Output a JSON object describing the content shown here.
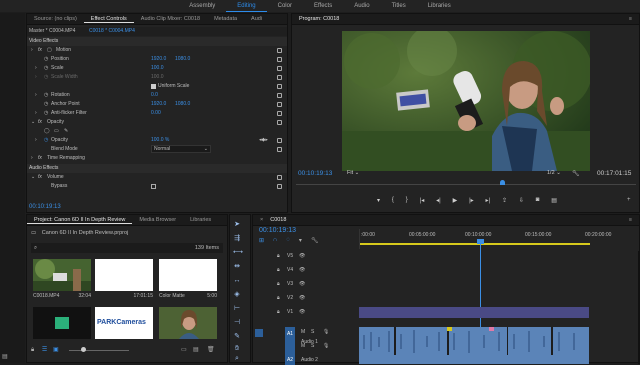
{
  "workspaces": [
    {
      "label": "Assembly"
    },
    {
      "label": "Editing",
      "active": true
    },
    {
      "label": "Color"
    },
    {
      "label": "Effects"
    },
    {
      "label": "Audio"
    },
    {
      "label": "Titles"
    },
    {
      "label": "Libraries"
    }
  ],
  "source_tabs": [
    "Source: (no clips)",
    "Effect Controls",
    "Audio Clip Mixer: C0018",
    "Metadata",
    "Audi"
  ],
  "effect_controls": {
    "master": "Master * C0004.MP4",
    "clip": "C0018 * C0004.MP4",
    "video_effects": "Video Effects",
    "motion": "Motion",
    "position_label": "Position",
    "position_x": "1920.0",
    "position_y": "1080.0",
    "scale_label": "Scale",
    "scale_val": "100.0",
    "scale_width_label": "Scale Width",
    "scale_width_val": "100.0",
    "uniform_scale": "Uniform Scale",
    "rotation_label": "Rotation",
    "rotation_val": "0.0",
    "anchor_label": "Anchor Point",
    "anchor_x": "1920.0",
    "anchor_y": "1080.0",
    "flicker_label": "Anti-flicker Filter",
    "flicker_val": "0.00",
    "opacity_section": "Opacity",
    "opacity_label": "Opacity",
    "opacity_val": "100.0 %",
    "blend_label": "Blend Mode",
    "blend_val": "Normal",
    "time_remap": "Time Remapping",
    "audio_effects": "Audio Effects",
    "volume": "Volume",
    "bypass_label": "Bypass",
    "timecode": "00:10:19:13"
  },
  "program": {
    "tab": "Program: C0018",
    "timecode": "00:10:19:13",
    "fit": "Fit",
    "fraction": "1/2",
    "duration": "00:17:01:15"
  },
  "project": {
    "tabs": [
      "Project: Canon 6D II In Depth Review",
      "Media Browser",
      "Libraries"
    ],
    "file": "Canon 6D II In Depth Review.prproj",
    "count": "139 Items",
    "items": [
      {
        "name": "C0018.MP4",
        "dur": "32:04"
      },
      {
        "name": "",
        "dur": "17:01:15"
      },
      {
        "name": "Color Matte",
        "dur": "5:00"
      }
    ],
    "logo_text": "PARKCameras"
  },
  "timeline": {
    "tab": "C0018",
    "timecode": "00:10:19:13",
    "ruler": [
      ":00:00",
      "00:05:00:00",
      "00:10:00:00",
      "00:15:00:00",
      "00:20:00:00"
    ],
    "tracks": [
      {
        "name": "V5"
      },
      {
        "name": "V4"
      },
      {
        "name": "V3"
      },
      {
        "name": "V2"
      },
      {
        "name": "V1"
      },
      {
        "name": "A1",
        "label": "Audio 1"
      },
      {
        "name": "A2",
        "label": "Audio 2"
      }
    ],
    "solo": "S",
    "mute": "M"
  }
}
